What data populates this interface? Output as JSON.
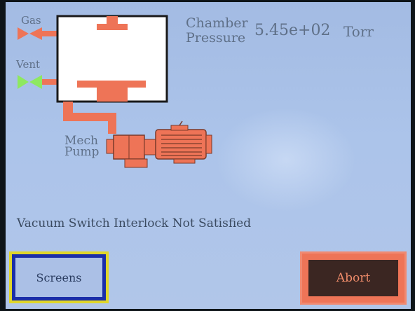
{
  "gas_label": "Gas",
  "vent_label": "Vent",
  "chamber_label_line1": "Chamber",
  "chamber_label_line2": "Pressure",
  "pressure_value": "5.45e+02",
  "pressure_unit": "Torr",
  "pump_label_line1": "Mech",
  "pump_label_line2": "Pump",
  "status_message": "Vacuum Switch Interlock Not Satisfied",
  "buttons": {
    "screens_label": "Screens",
    "abort_label": "Abort"
  },
  "colors": {
    "screen_bg": "#a9c0e6",
    "component_orange": "#ee7457",
    "vent_valve_green": "#8ee860",
    "screens_border": "#e0d62a",
    "screens_inner_border": "#1b2ea8",
    "abort_inner": "#3b2622"
  },
  "icons": {
    "gas_valve": "valve-icon",
    "vent_valve": "valve-icon",
    "pump": "mechanical-pump-icon"
  }
}
